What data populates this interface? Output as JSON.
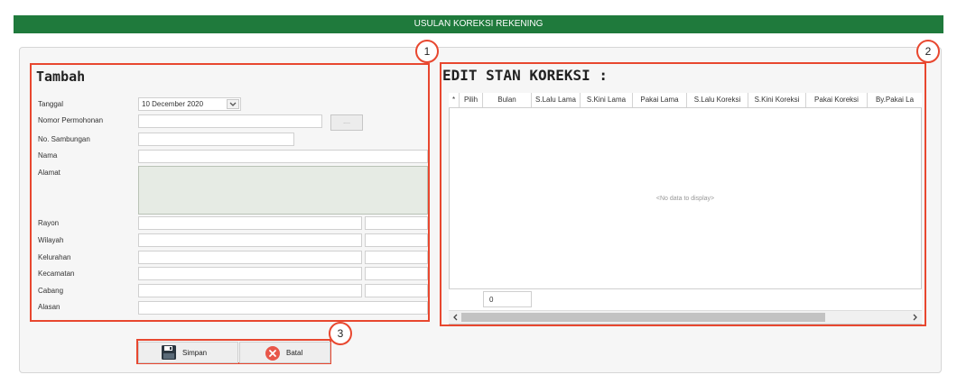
{
  "window_title": "USULAN KOREKSI REKENING",
  "annotation_markers": [
    "1",
    "2",
    "3"
  ],
  "form": {
    "heading": "Tambah",
    "fields": {
      "tanggal_label": "Tanggal",
      "tanggal_value": "10 December 2020",
      "nomor_permohonan_label": "Nomor Permohonan",
      "lookup_button": "....",
      "no_sambungan_label": "No. Sambungan",
      "nama_label": "Nama",
      "alamat_label": "Alamat",
      "rayon_label": "Rayon",
      "wilayah_label": "Wilayah",
      "kelurahan_label": "Kelurahan",
      "kecamatan_label": "Kecamatan",
      "cabang_label": "Cabang",
      "alasan_label": "Alasan"
    }
  },
  "grid": {
    "heading": "EDIT STAN KOREKSI :",
    "columns": [
      "*",
      "Pilih",
      "Bulan",
      "S.Lalu Lama",
      "S.Kini Lama",
      "Pakai Lama",
      "S.Lalu Koreksi",
      "S.Kini Koreksi",
      "Pakai Koreksi",
      "By.Pakai La"
    ],
    "empty_text": "<No data to display>",
    "footer_value": "0"
  },
  "actions": {
    "save_label": "Simpan",
    "cancel_label": "Batal"
  },
  "colors": {
    "title_bar": "#1f7a3c",
    "highlight": "#e8472f",
    "cancel_icon": "#e8574a",
    "save_icon": "#2b3640"
  }
}
